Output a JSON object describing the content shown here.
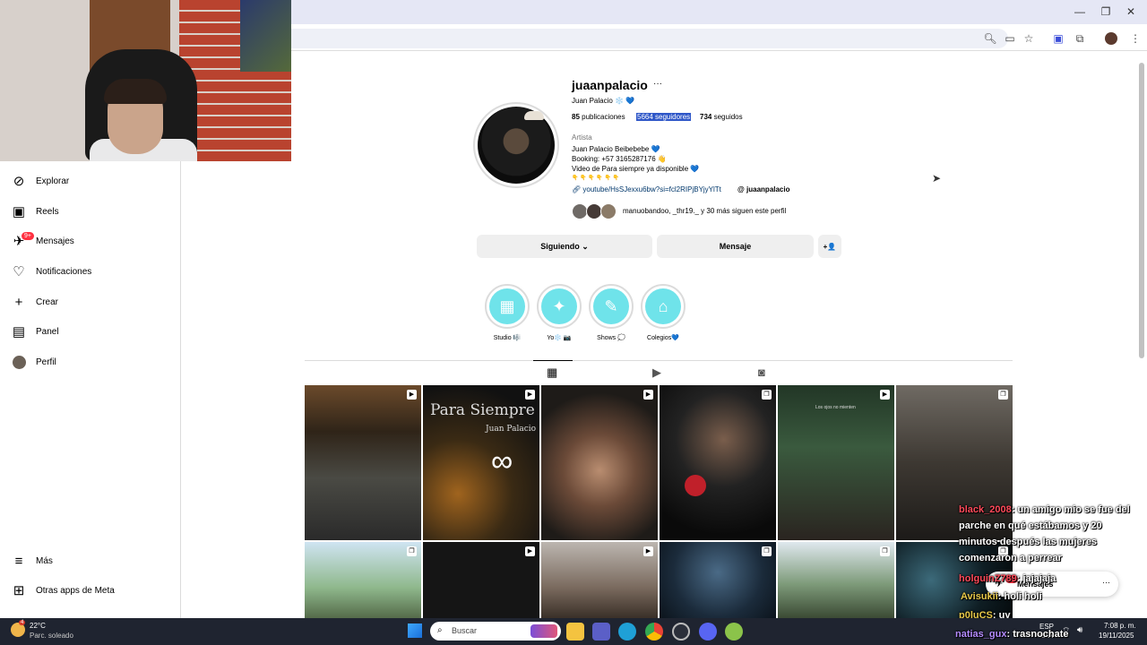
{
  "browser": {
    "minimize": "—",
    "restore": "❐",
    "close": "✕"
  },
  "sidebar": {
    "items": [
      {
        "label": "Explorar",
        "icon": "compass-icon"
      },
      {
        "label": "Reels",
        "icon": "reels-icon"
      },
      {
        "label": "Mensajes",
        "icon": "messenger-icon"
      },
      {
        "label": "Notificaciones",
        "icon": "heart-icon"
      },
      {
        "label": "Crear",
        "icon": "plus-icon"
      },
      {
        "label": "Panel",
        "icon": "chart-icon"
      },
      {
        "label": "Perfil",
        "icon": "avatar-icon"
      }
    ],
    "messages_badge": "9+",
    "more_label": "Más",
    "meta_apps_label": "Otras apps de Meta"
  },
  "profile": {
    "username": "juaanpalacio",
    "options": "···",
    "full_name": "Juan Palacio ❄️ 💙",
    "posts_count": "85",
    "posts_label": "publicaciones",
    "followers": "5664 seguidores",
    "following_count": "734",
    "following_label": "seguidos",
    "category": "Artista",
    "bio": [
      "Juan Palacio Beibebebe 💙",
      "Booking: +57 3165287176 👋",
      "Video de Para siempre ya disponible 💙",
      "👇 👇 👇 👇 👇 👇"
    ],
    "link": "youtube/HsSJexxu6bw?si=fcl2RIPjBYjyYlTt",
    "threads": "juaanpalacio",
    "followed_by": "manuobandoo, _thr19._ y 30 más siguen este perfil",
    "following_button": "Siguiendo ⌄",
    "message_button": "Mensaje",
    "suggest_icon": "+👤"
  },
  "highlights": [
    {
      "label": "Studio 🎼",
      "glyph": "▦"
    },
    {
      "label": "Yo❄️ 📷",
      "glyph": "✦"
    },
    {
      "label": "Shows 💭",
      "glyph": "✎"
    },
    {
      "label": "Colegios💙",
      "glyph": "⌂"
    }
  ],
  "tabs": {
    "grid": "▦",
    "reels": "▶",
    "tagged": "◙"
  },
  "posts": [
    {
      "title": ""
    },
    {
      "title": "Para Siempre",
      "subtitle": "Juan Palacio",
      "mark": "∞"
    },
    {
      "title": ""
    },
    {
      "title": ""
    },
    {
      "title": "Los ojos no mienten"
    },
    {
      "title": ""
    }
  ],
  "chat": [
    {
      "user": "black_2008",
      "text": ": un amigo mio se fue del"
    },
    {
      "user": "",
      "text": "parche en qué estábamos y 20"
    },
    {
      "user": "",
      "text": "minutos después las mujeres"
    },
    {
      "user": "",
      "text": "comenzaron a perrear"
    },
    {
      "user": "holguinZ789",
      "text": ": jajajaja"
    },
    {
      "user": "Avisukii",
      "text": ": holi holi"
    },
    {
      "user": "p0luCS",
      "text": ": uy"
    },
    {
      "user": "natias_gux",
      "text": ": trasnochate"
    }
  ],
  "messages_pill": "Mensajes",
  "taskbar": {
    "temp": "22°C",
    "weather": "Parc. soleado",
    "weather_badge": "4",
    "search": "Buscar",
    "lang": "ESP",
    "lang_sub": "LAA",
    "time": "7:08 p. m.",
    "date": "19/11/2025"
  },
  "colors": {
    "highlight_bg": "#6fe3ea",
    "link": "#00376b",
    "selection": "#2f57c8",
    "taskbar": "#1f2430"
  }
}
